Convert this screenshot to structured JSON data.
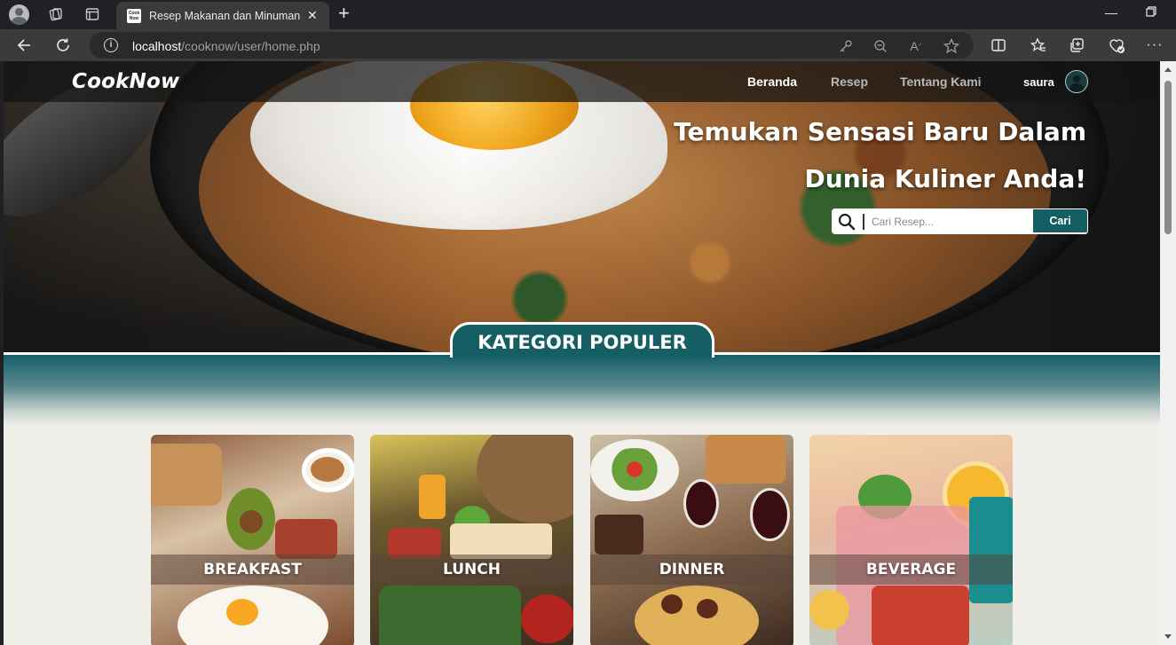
{
  "browser": {
    "tab_title": "Resep Makanan dan Minuman | C",
    "tab_favicon_text_1": "Cook",
    "tab_favicon_text_2": "Now",
    "url_host": "localhost",
    "url_path": "/cooknow/user/home.php"
  },
  "nav": {
    "logo": "CookNow",
    "links": [
      {
        "label": "Beranda",
        "active": true
      },
      {
        "label": "Resep",
        "active": false
      },
      {
        "label": "Tentang Kami",
        "active": false
      }
    ],
    "user_name": "saura"
  },
  "hero": {
    "headline_line1": "Temukan Sensasi Baru Dalam",
    "headline_line2": "Dunia Kuliner Anda!",
    "search_placeholder": "Cari Resep...",
    "search_button": "Cari"
  },
  "section": {
    "title": "KATEGORI POPULER"
  },
  "categories": [
    {
      "label": "BREAKFAST"
    },
    {
      "label": "LUNCH"
    },
    {
      "label": "DINNER"
    },
    {
      "label": "BEVERAGE"
    }
  ],
  "colors": {
    "accent_teal": "#155e63",
    "page_background": "#f1efe9"
  }
}
